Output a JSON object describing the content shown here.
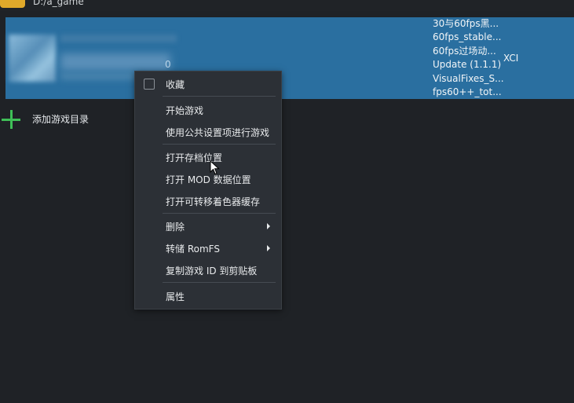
{
  "path": {
    "text": "D:/a_game"
  },
  "game": {
    "version_fragment": "0",
    "mods": [
      "30与60fps黑...",
      "60fps_stable...",
      "60fps过场动...",
      "Update (1.1.1)",
      "VisualFixes_S...",
      "fps60++_tot..."
    ],
    "file_type": "XCI"
  },
  "add_dir": {
    "label": "添加游戏目录"
  },
  "menu": {
    "favorite": "收藏",
    "start": "开始游戏",
    "start_global": "使用公共设置项进行游戏",
    "open_save": "打开存档位置",
    "open_mod": "打开 MOD 数据位置",
    "open_shader": "打开可转移着色器缓存",
    "delete": "删除",
    "dump_romfs": "转储 RomFS",
    "copy_id": "复制游戏 ID 到剪贴板",
    "properties": "属性"
  },
  "colors": {
    "background": "#1f2226",
    "selection": "#2a6fa0",
    "menu_bg": "#2c3036",
    "accent_plus": "#3fbf57",
    "folder": "#e0a92a"
  },
  "icons": {
    "folder": "folder-icon",
    "plus": "plus-icon",
    "checkbox": "checkbox-icon",
    "submenu": "chevron-right-icon",
    "cursor": "mouse-pointer-icon"
  }
}
